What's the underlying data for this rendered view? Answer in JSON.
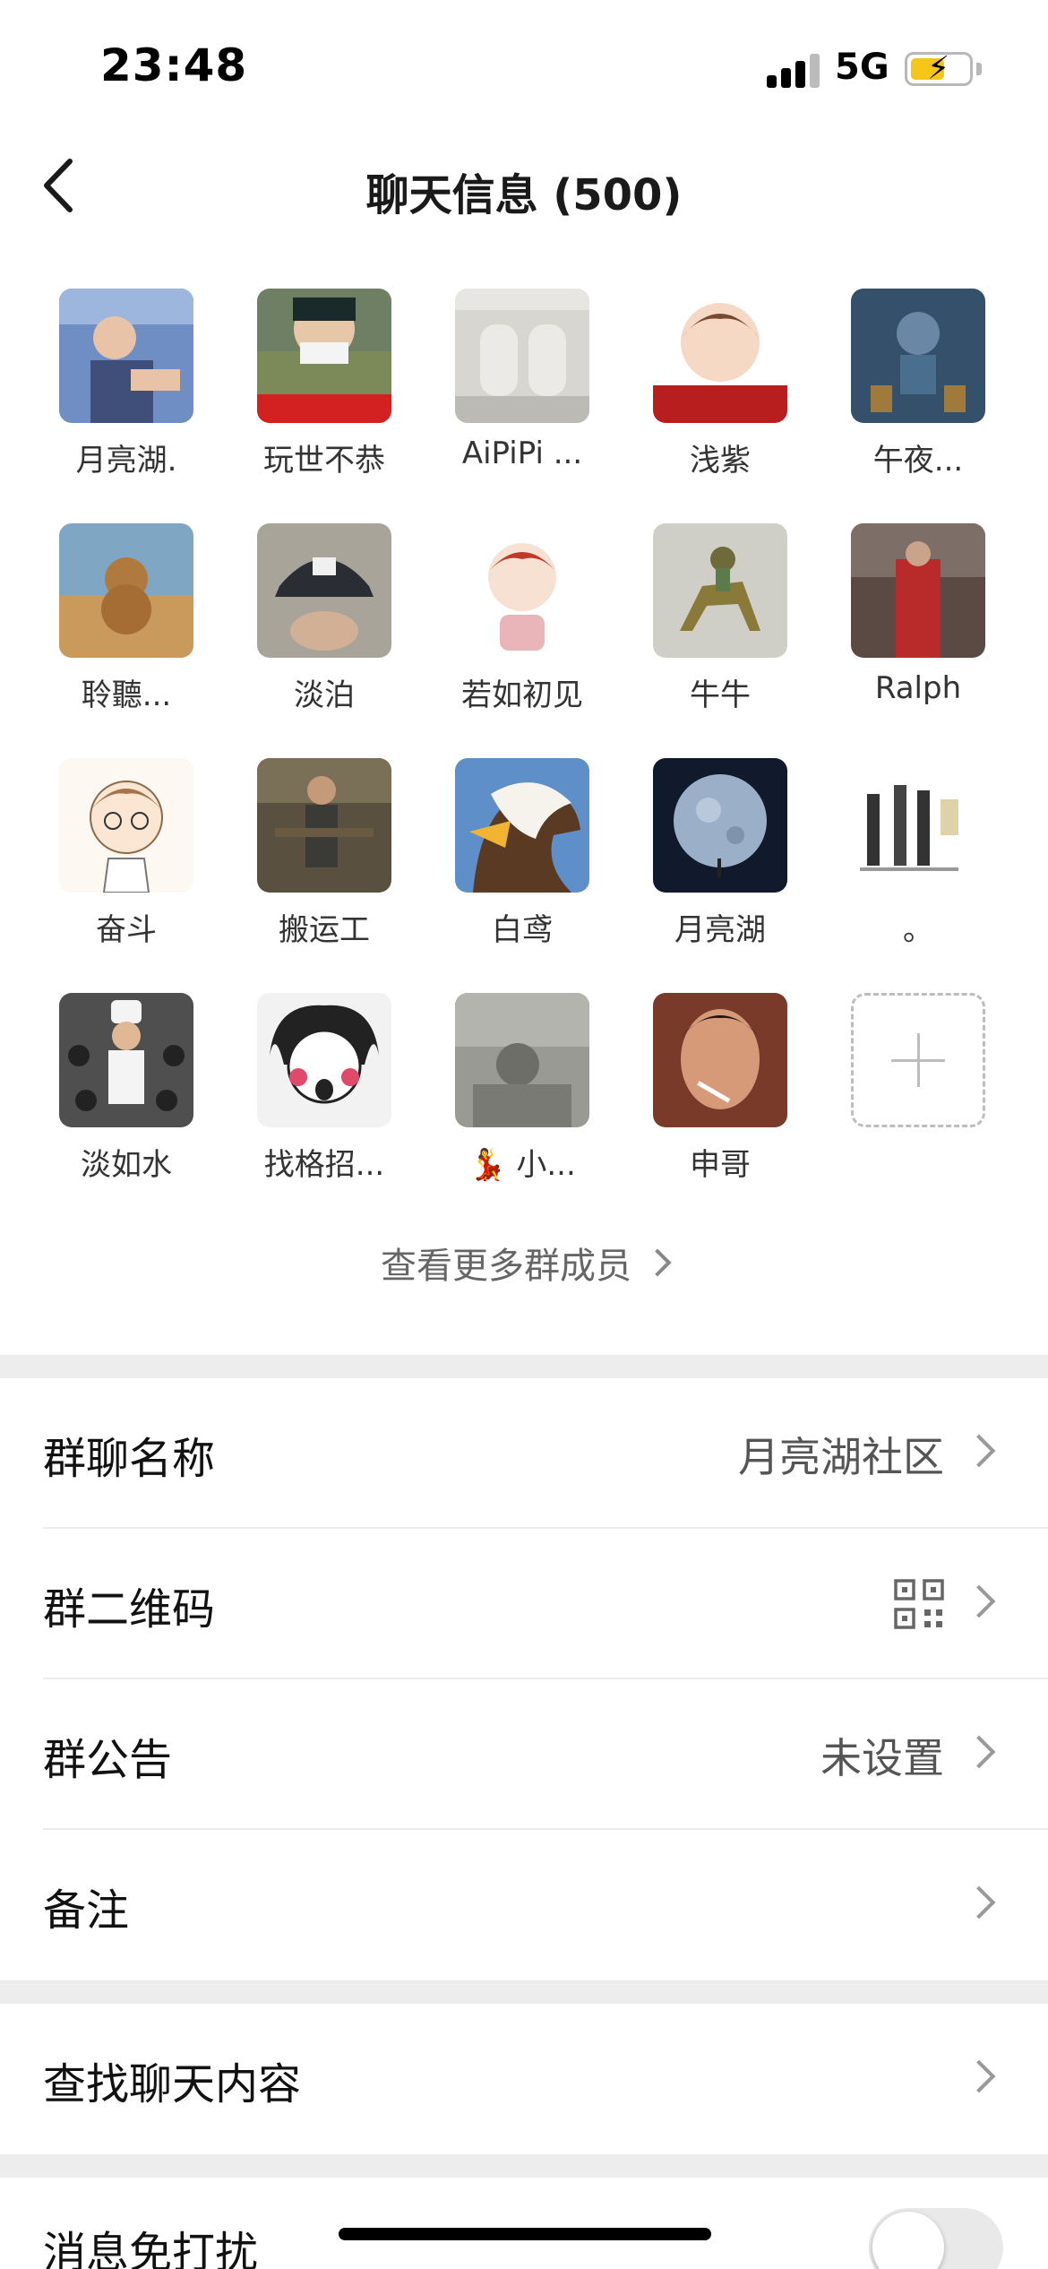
{
  "status_bar": {
    "time": "23:48",
    "network": "5G",
    "battery_level": 0.6,
    "battery_color": "#f5c518"
  },
  "nav": {
    "title": "聊天信息 (500)",
    "back_icon": "chevron-left-icon"
  },
  "members": [
    {
      "name": "月亮湖.",
      "avatar_color": "#6f8fc4"
    },
    {
      "name": "玩世不恭",
      "avatar_color": "#7c8a5a"
    },
    {
      "name": "AiPiPi ...",
      "avatar_color": "#d8d6d1"
    },
    {
      "name": "浅紫",
      "avatar_color": "#f4e3d7"
    },
    {
      "name": "午夜...",
      "avatar_color": "#35506b"
    },
    {
      "name": "聆聽...",
      "avatar_color": "#c99a5b"
    },
    {
      "name": "淡泊",
      "avatar_color": "#8a8a84"
    },
    {
      "name": "若如初见",
      "avatar_color": "#fbeeee"
    },
    {
      "name": "牛牛",
      "avatar_color": "#9b9479"
    },
    {
      "name": "Ralph",
      "avatar_color": "#5b4a44"
    },
    {
      "name": "奋斗",
      "avatar_color": "#fdf8f2"
    },
    {
      "name": "搬运工",
      "avatar_color": "#59503f"
    },
    {
      "name": "白鸢",
      "avatar_color": "#5e8fc8"
    },
    {
      "name": "月亮湖",
      "avatar_color": "#101a2c"
    },
    {
      "name": "。",
      "avatar_color": "#ffffff"
    },
    {
      "name": "淡如水",
      "avatar_color": "#4f4f4f"
    },
    {
      "name": "找格招...",
      "avatar_color": "#f2f2f2"
    },
    {
      "name": "💃 小...",
      "avatar_color": "#9a9a94"
    },
    {
      "name": "申哥",
      "avatar_color": "#a5654a"
    }
  ],
  "add_member_icon": "plus-icon",
  "more_members_label": "查看更多群成员",
  "settings": {
    "group_name": {
      "label": "群聊名称",
      "value": "月亮湖社区"
    },
    "qr_code": {
      "label": "群二维码",
      "icon": "qr-code-icon"
    },
    "announcement": {
      "label": "群公告",
      "value": "未设置"
    },
    "remark": {
      "label": "备注"
    },
    "search_chat": {
      "label": "查找聊天内容"
    },
    "mute": {
      "label": "消息免打扰",
      "enabled": false
    }
  },
  "colors": {
    "separator": "#ededed",
    "toggle_off": "#e9e9ea"
  }
}
